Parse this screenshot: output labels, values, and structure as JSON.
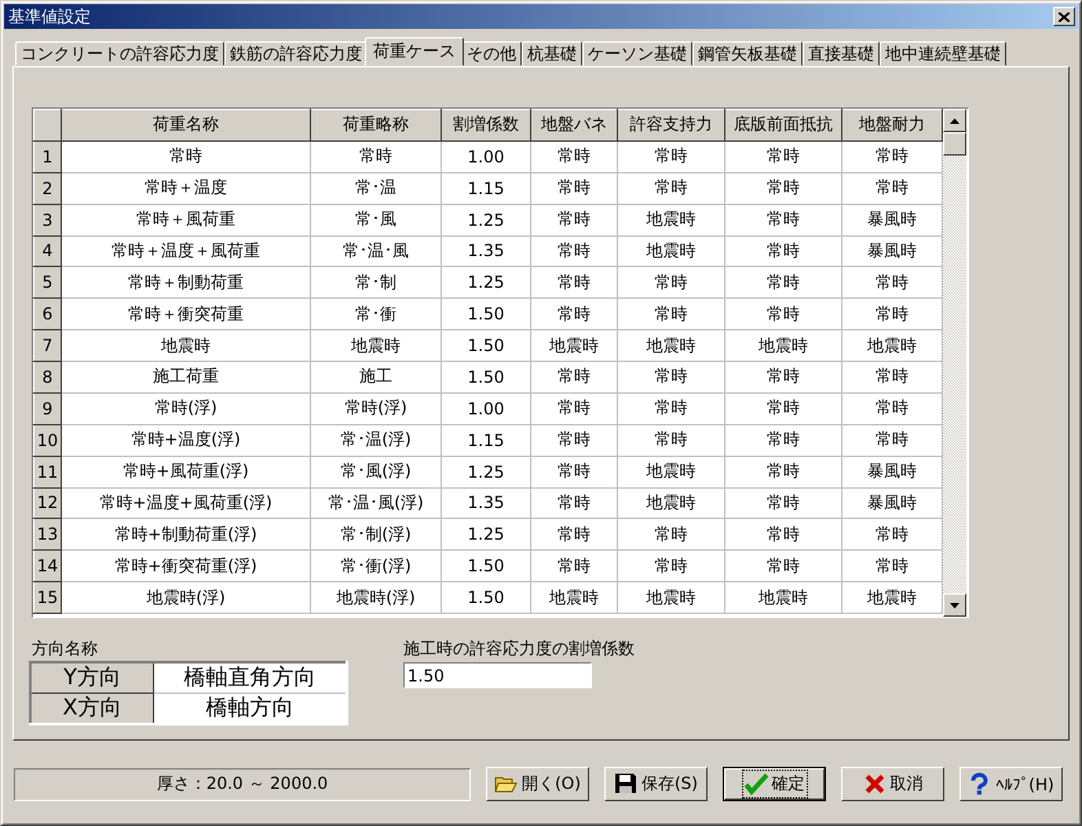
{
  "window": {
    "title": "基準値設定"
  },
  "tabs": [
    {
      "label": "コンクリートの許容応力度",
      "selected": false
    },
    {
      "label": "鉄筋の許容応力度",
      "selected": false
    },
    {
      "label": "荷重ケース",
      "selected": true
    },
    {
      "label": "その他",
      "selected": false
    },
    {
      "label": "杭基礎",
      "selected": false
    },
    {
      "label": "ケーソン基礎",
      "selected": false
    },
    {
      "label": "鋼管矢板基礎",
      "selected": false
    },
    {
      "label": "直接基礎",
      "selected": false
    },
    {
      "label": "地中連続壁基礎",
      "selected": false
    }
  ],
  "table": {
    "columns": [
      "荷重名称",
      "荷重略称",
      "割増係数",
      "地盤バネ",
      "許容支持力",
      "底版前面抵抗",
      "地盤耐力"
    ],
    "rows": [
      {
        "number": "1",
        "cells": [
          "常時",
          "常時",
          "1.00",
          "常時",
          "常時",
          "常時",
          "常時"
        ]
      },
      {
        "number": "2",
        "cells": [
          "常時＋温度",
          "常･温",
          "1.15",
          "常時",
          "常時",
          "常時",
          "常時"
        ]
      },
      {
        "number": "3",
        "cells": [
          "常時＋風荷重",
          "常･風",
          "1.25",
          "常時",
          "地震時",
          "常時",
          "暴風時"
        ]
      },
      {
        "number": "4",
        "cells": [
          "常時＋温度＋風荷重",
          "常･温･風",
          "1.35",
          "常時",
          "地震時",
          "常時",
          "暴風時"
        ]
      },
      {
        "number": "5",
        "cells": [
          "常時＋制動荷重",
          "常･制",
          "1.25",
          "常時",
          "常時",
          "常時",
          "常時"
        ]
      },
      {
        "number": "6",
        "cells": [
          "常時＋衝突荷重",
          "常･衝",
          "1.50",
          "常時",
          "常時",
          "常時",
          "常時"
        ]
      },
      {
        "number": "7",
        "cells": [
          "地震時",
          "地震時",
          "1.50",
          "地震時",
          "地震時",
          "地震時",
          "地震時"
        ]
      },
      {
        "number": "8",
        "cells": [
          "施工荷重",
          "施工",
          "1.50",
          "常時",
          "常時",
          "常時",
          "常時"
        ]
      },
      {
        "number": "9",
        "cells": [
          "常時(浮)",
          "常時(浮)",
          "1.00",
          "常時",
          "常時",
          "常時",
          "常時"
        ]
      },
      {
        "number": "10",
        "cells": [
          "常時+温度(浮)",
          "常･温(浮)",
          "1.15",
          "常時",
          "常時",
          "常時",
          "常時"
        ]
      },
      {
        "number": "11",
        "cells": [
          "常時+風荷重(浮)",
          "常･風(浮)",
          "1.25",
          "常時",
          "地震時",
          "常時",
          "暴風時"
        ]
      },
      {
        "number": "12",
        "cells": [
          "常時+温度+風荷重(浮)",
          "常･温･風(浮)",
          "1.35",
          "常時",
          "地震時",
          "常時",
          "暴風時"
        ]
      },
      {
        "number": "13",
        "cells": [
          "常時+制動荷重(浮)",
          "常･制(浮)",
          "1.25",
          "常時",
          "常時",
          "常時",
          "常時"
        ]
      },
      {
        "number": "14",
        "cells": [
          "常時+衝突荷重(浮)",
          "常･衝(浮)",
          "1.50",
          "常時",
          "常時",
          "常時",
          "常時"
        ]
      },
      {
        "number": "15",
        "cells": [
          "地震時(浮)",
          "地震時(浮)",
          "1.50",
          "地震時",
          "地震時",
          "地震時",
          "地震時"
        ]
      }
    ]
  },
  "direction": {
    "label": "方向名称",
    "rows": [
      {
        "header": "Y方向",
        "value": "橋軸直角方向"
      },
      {
        "header": "X方向",
        "value": "橋軸方向"
      }
    ]
  },
  "factor": {
    "label": "施工時の許容応力度の割増係数",
    "value": "1.50"
  },
  "status_bar": "厚さ：20.0 ～ 2000.0",
  "buttons": [
    {
      "kind": "open",
      "label": "開く(O)",
      "default": false
    },
    {
      "kind": "save",
      "label": "保存(S)",
      "default": false
    },
    {
      "kind": "ok",
      "label": "確定",
      "default": true
    },
    {
      "kind": "cancel",
      "label": "取消",
      "default": false
    },
    {
      "kind": "help",
      "label": "ﾍﾙﾌﾟ(H)",
      "default": false
    }
  ]
}
